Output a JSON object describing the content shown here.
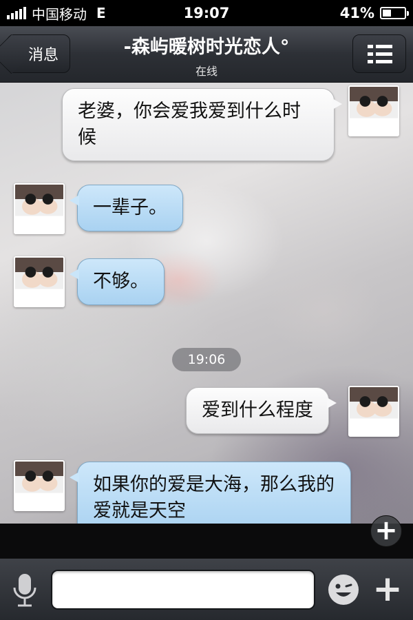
{
  "status_bar": {
    "carrier": "中国移动",
    "network": "E",
    "time": "19:07",
    "battery_percent": "41%",
    "battery_level": 0.41
  },
  "nav": {
    "back_label": "消息",
    "title": "-森屿暖树时光恋人°",
    "subtitle": "在线",
    "menu_icon": "list-icon"
  },
  "messages": [
    {
      "from": "me",
      "text": "老婆，你会爱我爱到什么时候"
    },
    {
      "from": "them",
      "text": "一辈子。"
    },
    {
      "from": "them",
      "text": "不够。"
    },
    {
      "from": "me",
      "text": "爱到什么程度"
    },
    {
      "from": "them",
      "text": "如果你的爱是大海，那么我的爱就是天空"
    }
  ],
  "timestamp": "19:06",
  "input": {
    "placeholder": "",
    "mic_icon": "microphone-icon",
    "emoji_icon": "emoji-icon",
    "plus_icon": "plus-icon"
  },
  "colors": {
    "my_bubble": "#f4f4f5",
    "their_bubble": "#b9dcf5",
    "navbar": "#2d3036"
  }
}
